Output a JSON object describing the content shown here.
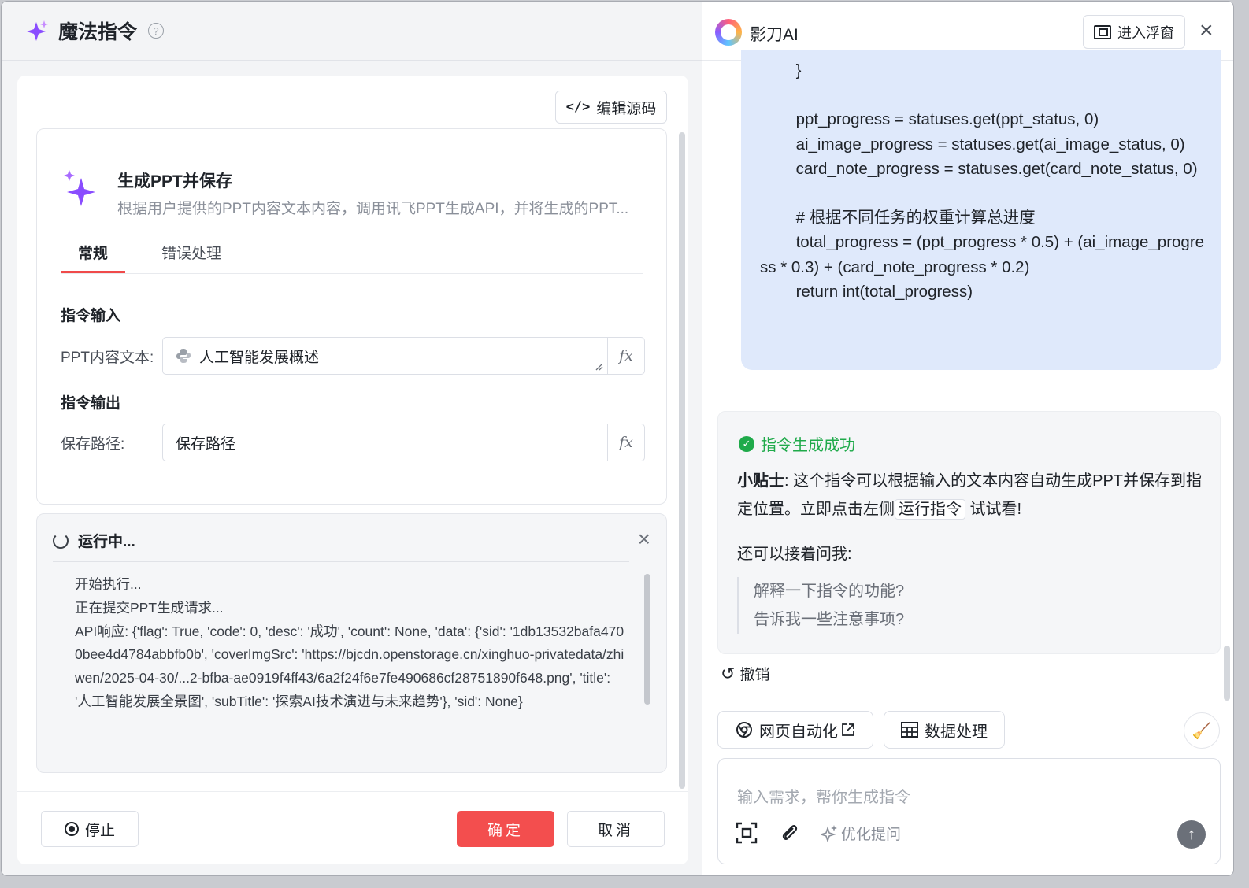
{
  "left": {
    "title": "魔法指令",
    "help_icon": "?",
    "edit_source_label": "编辑源码",
    "command": {
      "title": "生成PPT并保存",
      "description": "根据用户提供的PPT内容文本内容，调用讯飞PPT生成API，并将生成的PPT..."
    },
    "tabs": [
      "常规",
      "错误处理"
    ],
    "input_section": "指令输入",
    "output_section": "指令输出",
    "ppt_field": {
      "label": "PPT内容文本:",
      "value": "人工智能发展概述"
    },
    "save_field": {
      "label": "保存路径:",
      "value": "保存路径"
    },
    "fx_label": "fx",
    "run": {
      "title": "运行中...",
      "close": "×",
      "log": [
        "开始执行...",
        "正在提交PPT生成请求...",
        "API响应: {'flag': True, 'code': 0, 'desc': '成功', 'count': None, 'data': {'sid': '1db13532bafa4700bee4d4784abbfb0b', 'coverImgSrc': 'https://bjcdn.openstorage.cn/xinghuo-privatedata/zhiwen/2025-04-30/...2-bfba-ae0919f4ff43/6a2f24f6e7fe490686cf28751890f648.png', 'title': '人工智能发展全景图', 'subTitle': '探索AI技术演进与未来趋势'}, 'sid': None}"
      ]
    },
    "stop_label": "停止",
    "ok_label": "确定",
    "cancel_label": "取消"
  },
  "right": {
    "brand": "影刀AI",
    "float_label": "进入浮窗",
    "close": "×",
    "code": "        }\n\n        ppt_progress = statuses.get(ppt_status, 0)\n        ai_image_progress = statuses.get(ai_image_status, 0)\n        card_note_progress = statuses.get(card_note_status, 0)\n\n        # 根据不同任务的权重计算总进度\n        total_progress = (ppt_progress * 0.5) + (ai_image_progress * 0.3) + (card_note_progress * 0.2)\n        return int(total_progress)",
    "success_text": "指令生成成功",
    "tip_label": "小贴士",
    "tip_text_1": ": 这个指令可以根据输入的文本内容自动生成PPT并保存到指定位置。立即点击左侧",
    "tip_code": "运行指令",
    "tip_text_2": " 试试看!",
    "ask_text": "还可以接着问我:",
    "suggestions": [
      "解释一下指令的功能?",
      "告诉我一些注意事项?"
    ],
    "undo_label": "撤销",
    "chip_web": "网页自动化",
    "chip_data": "数据处理",
    "input_placeholder": "输入需求，帮你生成指令",
    "optimize_label": "优化提问"
  },
  "colors": {
    "accent_red": "#f34e4e",
    "success_green": "#1faa4a",
    "code_bg": "#dfe9fb",
    "sparkle_purple": "#8a4dff"
  }
}
